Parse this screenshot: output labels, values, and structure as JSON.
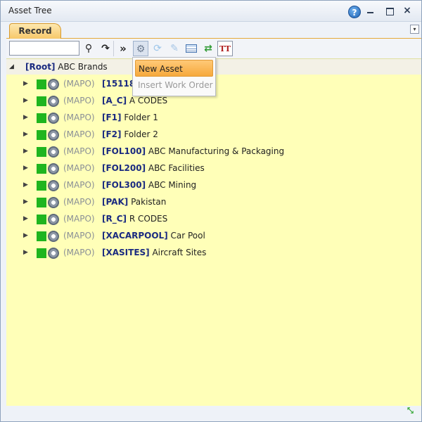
{
  "window": {
    "title": "Asset Tree",
    "help_glyph": "?",
    "close_glyph": "×"
  },
  "tabs": {
    "record_label": "Record",
    "menu_glyph": "▾"
  },
  "toolbar": {
    "search_value": "",
    "icons": [
      "search-icon",
      "refresh-icon",
      "expand-icon",
      "gear-icon",
      "sync-icon",
      "wrench-icon",
      "grid-icon",
      "swap-icon",
      "text-icon"
    ],
    "text_icon_label": "TT"
  },
  "tree": {
    "root": {
      "code": "[Root]",
      "name": "ABC Brands"
    },
    "rows": [
      {
        "type": "(MAPO)",
        "code": "[15118",
        "name": ""
      },
      {
        "type": "(MAPO)",
        "code": "[A_C]",
        "name": "A CODES"
      },
      {
        "type": "(MAPO)",
        "code": "[F1]",
        "name": "Folder 1"
      },
      {
        "type": "(MAPO)",
        "code": "[F2]",
        "name": "Folder 2"
      },
      {
        "type": "(MAPO)",
        "code": "[FOL100]",
        "name": "ABC Manufacturing & Packaging"
      },
      {
        "type": "(MAPO)",
        "code": "[FOL200]",
        "name": "ABC Facilities"
      },
      {
        "type": "(MAPO)",
        "code": "[FOL300]",
        "name": "ABC Mining"
      },
      {
        "type": "(MAPO)",
        "code": "[PAK]",
        "name": "Pakistan"
      },
      {
        "type": "(MAPO)",
        "code": "[R_C]",
        "name": "R CODES"
      },
      {
        "type": "(MAPO)",
        "code": "[XACARPOOL]",
        "name": "Car Pool"
      },
      {
        "type": "(MAPO)",
        "code": "[XASITES]",
        "name": "Aircraft Sites"
      }
    ]
  },
  "dropdown": {
    "items": [
      {
        "label": "New Asset",
        "state": "active"
      },
      {
        "label": "Insert Work Order",
        "state": "disabled"
      }
    ]
  },
  "colors": {
    "tree_background": "#ffffb8",
    "status_green": "#1fb51f",
    "tab_orange": "#f7c86a",
    "code_blue": "#1a2a80"
  }
}
